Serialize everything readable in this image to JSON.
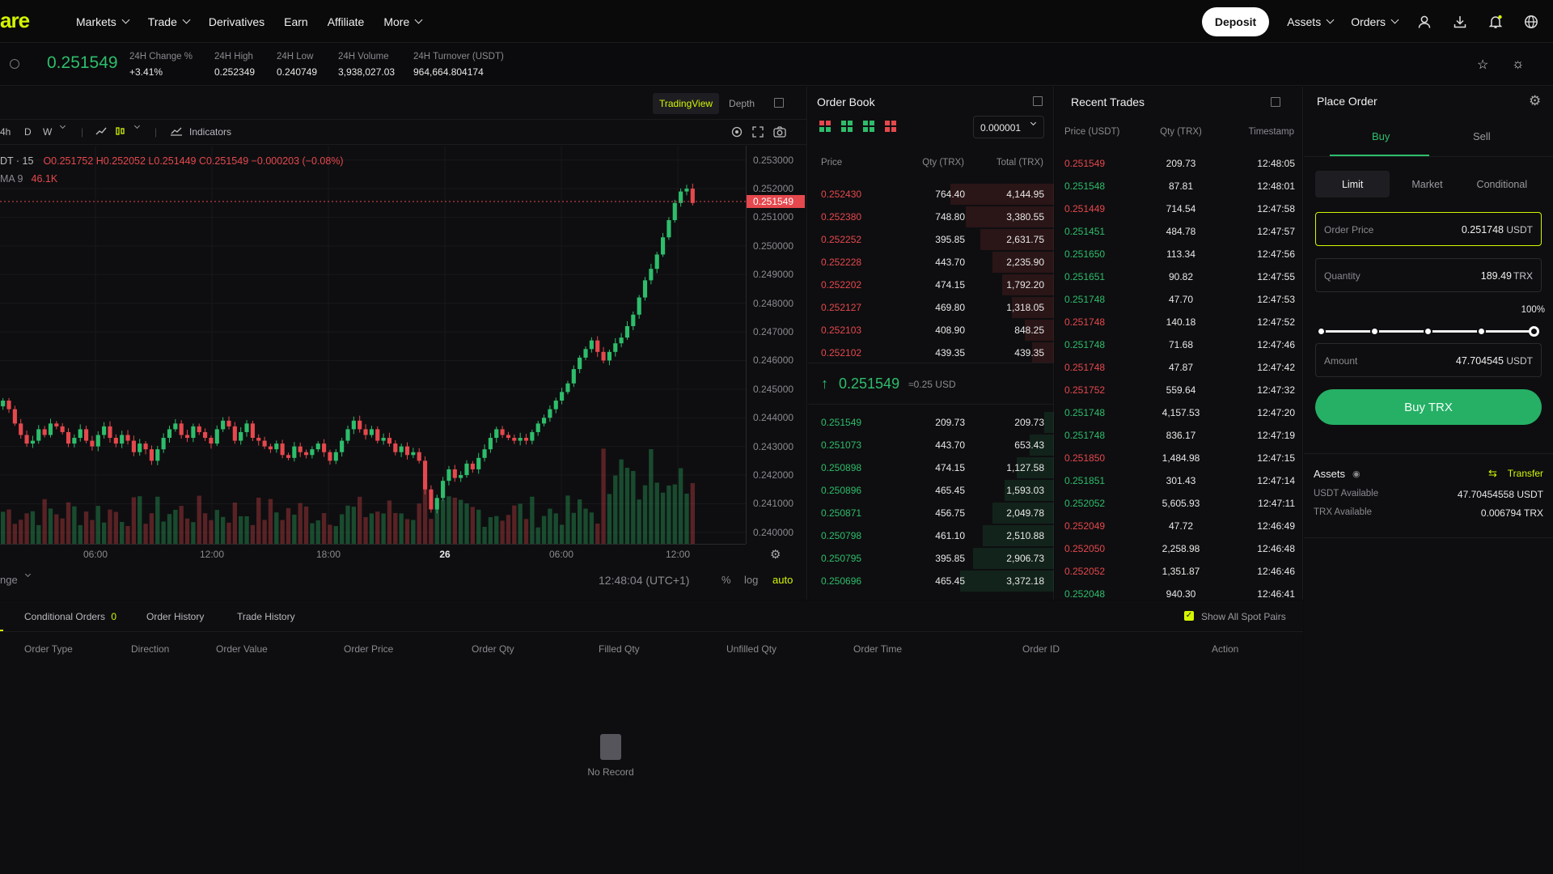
{
  "brand": {
    "logo_text": "are"
  },
  "nav": {
    "items": [
      {
        "label": "Markets",
        "dropdown": true
      },
      {
        "label": "Trade",
        "dropdown": true
      },
      {
        "label": "Derivatives",
        "dropdown": false
      },
      {
        "label": "Earn",
        "dropdown": false
      },
      {
        "label": "Affiliate",
        "dropdown": false
      },
      {
        "label": "More",
        "dropdown": true
      }
    ]
  },
  "top_right": {
    "deposit_label": "Deposit",
    "assets_label": "Assets",
    "orders_label": "Orders",
    "icons": [
      "user-icon",
      "download-icon",
      "bell-icon",
      "globe-icon"
    ]
  },
  "ticker": {
    "last_price": "0.251549",
    "change_label": "24H Change %",
    "change_value": "+3.41%",
    "high_label": "24H High",
    "high_value": "0.252349",
    "low_label": "24H Low",
    "low_value": "0.240749",
    "volume_label": "24H Volume",
    "volume_value": "3,938,027.03",
    "turnover_label": "24H Turnover (USDT)",
    "turnover_value": "964,664.804174"
  },
  "chart": {
    "view_tabs": [
      "TradingView",
      "Depth"
    ],
    "active_view": "TradingView",
    "toolbar": {
      "intervals": [
        "4h",
        "D",
        "W"
      ],
      "indicators_label": "Indicators"
    },
    "symbol_label": "DT · 15",
    "ohlc": "O0.251752  H0.252052  L0.251449  C0.251549  −0.000203 (−0.08%)",
    "ma_label": "MA 9",
    "ma_value": "46.1K",
    "current_price_tag": "0.251549",
    "time_readout": "12:48:04 (UTC+1)",
    "range_label": "nge",
    "footer_toggles": [
      "%",
      "log",
      "auto"
    ]
  },
  "chart_data": {
    "type": "candlestick",
    "title": "",
    "y_ticks": [
      "0.253000",
      "0.252000",
      "0.251000",
      "0.250000",
      "0.249000",
      "0.248000",
      "0.247000",
      "0.246000",
      "0.245000",
      "0.244000",
      "0.243000",
      "0.242000",
      "0.241000",
      "0.240000"
    ],
    "ylim": [
      0.2396,
      0.2535
    ],
    "x_ticks": [
      "06:00",
      "12:00",
      "18:00",
      "26",
      "06:00",
      "12:00"
    ],
    "close_series": [
      0.2446,
      0.2443,
      0.2438,
      0.2434,
      0.2431,
      0.2432,
      0.2436,
      0.2434,
      0.2438,
      0.2437,
      0.2435,
      0.2431,
      0.2433,
      0.2436,
      0.2432,
      0.243,
      0.2434,
      0.2437,
      0.2433,
      0.2431,
      0.2434,
      0.2432,
      0.2428,
      0.2431,
      0.2429,
      0.2425,
      0.2429,
      0.2433,
      0.2436,
      0.2438,
      0.2434,
      0.2433,
      0.2437,
      0.2435,
      0.2433,
      0.2431,
      0.2436,
      0.2439,
      0.2437,
      0.2432,
      0.2435,
      0.2438,
      0.2433,
      0.2432,
      0.243,
      0.2429,
      0.2431,
      0.2427,
      0.2426,
      0.243,
      0.2428,
      0.2427,
      0.2429,
      0.2431,
      0.2428,
      0.2425,
      0.2428,
      0.2432,
      0.2436,
      0.2439,
      0.2436,
      0.2434,
      0.2436,
      0.2432,
      0.2433,
      0.2431,
      0.2428,
      0.243,
      0.2427,
      0.2428,
      0.2425,
      0.2415,
      0.2408,
      0.2412,
      0.2418,
      0.2422,
      0.2419,
      0.242,
      0.2424,
      0.2422,
      0.2426,
      0.2429,
      0.2433,
      0.2436,
      0.2434,
      0.2433,
      0.2432,
      0.2433,
      0.2432,
      0.2435,
      0.2438,
      0.244,
      0.2443,
      0.2446,
      0.2449,
      0.2452,
      0.2457,
      0.2461,
      0.2464,
      0.2467,
      0.2463,
      0.246,
      0.2463,
      0.2466,
      0.2468,
      0.2472,
      0.2476,
      0.2482,
      0.2488,
      0.2492,
      0.2497,
      0.2503,
      0.2509,
      0.2515,
      0.2519,
      0.252,
      0.2515
    ]
  },
  "order_book": {
    "title": "Order Book",
    "precision": "0.000001",
    "col_price": "Price",
    "col_qty": "Qty (TRX)",
    "col_total": "Total (TRX)",
    "asks": [
      {
        "price": "0.252430",
        "qty": "764.40",
        "total": "4,144.95",
        "depth": 0.42
      },
      {
        "price": "0.252380",
        "qty": "748.80",
        "total": "3,380.55",
        "depth": 0.36
      },
      {
        "price": "0.252252",
        "qty": "395.85",
        "total": "2,631.75",
        "depth": 0.3
      },
      {
        "price": "0.252228",
        "qty": "443.70",
        "total": "2,235.90",
        "depth": 0.25
      },
      {
        "price": "0.252202",
        "qty": "474.15",
        "total": "1,792.20",
        "depth": 0.21
      },
      {
        "price": "0.252127",
        "qty": "469.80",
        "total": "1,318.05",
        "depth": 0.17
      },
      {
        "price": "0.252103",
        "qty": "408.90",
        "total": "848.25",
        "depth": 0.12
      },
      {
        "price": "0.252102",
        "qty": "439.35",
        "total": "439.35",
        "depth": 0.09
      }
    ],
    "mid_price": "0.251549",
    "mid_usd": "≈0.25 USD",
    "bids": [
      {
        "price": "0.251549",
        "qty": "209.73",
        "total": "209.73",
        "depth": 0.04
      },
      {
        "price": "0.251073",
        "qty": "443.70",
        "total": "653.43",
        "depth": 0.1
      },
      {
        "price": "0.250898",
        "qty": "474.15",
        "total": "1,127.58",
        "depth": 0.15
      },
      {
        "price": "0.250896",
        "qty": "465.45",
        "total": "1,593.03",
        "depth": 0.2
      },
      {
        "price": "0.250871",
        "qty": "456.75",
        "total": "2,049.78",
        "depth": 0.25
      },
      {
        "price": "0.250798",
        "qty": "461.10",
        "total": "2,510.88",
        "depth": 0.29
      },
      {
        "price": "0.250795",
        "qty": "395.85",
        "total": "2,906.73",
        "depth": 0.33
      },
      {
        "price": "0.250696",
        "qty": "465.45",
        "total": "3,372.18",
        "depth": 0.38
      }
    ]
  },
  "recent_trades": {
    "title": "Recent Trades",
    "col_price": "Price (USDT)",
    "col_qty": "Qty (TRX)",
    "col_time": "Timestamp",
    "rows": [
      {
        "price": "0.251549",
        "qty": "209.73",
        "time": "12:48:05",
        "side": "sell"
      },
      {
        "price": "0.251548",
        "qty": "87.81",
        "time": "12:48:01",
        "side": "buy"
      },
      {
        "price": "0.251449",
        "qty": "714.54",
        "time": "12:47:58",
        "side": "sell"
      },
      {
        "price": "0.251451",
        "qty": "484.78",
        "time": "12:47:57",
        "side": "buy"
      },
      {
        "price": "0.251650",
        "qty": "113.34",
        "time": "12:47:56",
        "side": "buy"
      },
      {
        "price": "0.251651",
        "qty": "90.82",
        "time": "12:47:55",
        "side": "buy"
      },
      {
        "price": "0.251748",
        "qty": "47.70",
        "time": "12:47:53",
        "side": "buy"
      },
      {
        "price": "0.251748",
        "qty": "140.18",
        "time": "12:47:52",
        "side": "sell"
      },
      {
        "price": "0.251748",
        "qty": "71.68",
        "time": "12:47:46",
        "side": "buy"
      },
      {
        "price": "0.251748",
        "qty": "47.87",
        "time": "12:47:42",
        "side": "sell"
      },
      {
        "price": "0.251752",
        "qty": "559.64",
        "time": "12:47:32",
        "side": "sell"
      },
      {
        "price": "0.251748",
        "qty": "4,157.53",
        "time": "12:47:20",
        "side": "buy"
      },
      {
        "price": "0.251748",
        "qty": "836.17",
        "time": "12:47:19",
        "side": "buy"
      },
      {
        "price": "0.251850",
        "qty": "1,484.98",
        "time": "12:47:15",
        "side": "sell"
      },
      {
        "price": "0.251851",
        "qty": "301.43",
        "time": "12:47:14",
        "side": "buy"
      },
      {
        "price": "0.252052",
        "qty": "5,605.93",
        "time": "12:47:11",
        "side": "buy"
      },
      {
        "price": "0.252049",
        "qty": "47.72",
        "time": "12:46:49",
        "side": "sell"
      },
      {
        "price": "0.252050",
        "qty": "2,258.98",
        "time": "12:46:48",
        "side": "sell"
      },
      {
        "price": "0.252052",
        "qty": "1,351.87",
        "time": "12:46:46",
        "side": "sell"
      },
      {
        "price": "0.252048",
        "qty": "940.30",
        "time": "12:46:41",
        "side": "buy"
      }
    ]
  },
  "place_order": {
    "title": "Place Order",
    "side_buy": "Buy",
    "side_sell": "Sell",
    "types": [
      "Limit",
      "Market",
      "Conditional"
    ],
    "active_type": "Limit",
    "order_price_label": "Order Price",
    "order_price_value": "0.251748",
    "order_price_unit": "USDT",
    "quantity_label": "Quantity",
    "quantity_value": "189.49",
    "quantity_unit": "TRX",
    "slider_percent_label": "100%",
    "slider_value": 1.0,
    "amount_label": "Amount",
    "amount_value": "47.704545",
    "amount_unit": "USDT",
    "buy_button": "Buy TRX"
  },
  "assets": {
    "title": "Assets",
    "transfer_label": "Transfer",
    "rows": [
      {
        "label": "USDT Available",
        "value": "47.70454558 USDT"
      },
      {
        "label": "TRX Available",
        "value": "0.006794 TRX"
      }
    ]
  },
  "orders_panel": {
    "tabs": [
      {
        "label": "Conditional Orders",
        "count": "0"
      },
      {
        "label": "Order History",
        "count": ""
      },
      {
        "label": "Trade History",
        "count": ""
      }
    ],
    "show_all_label": "Show All Spot Pairs",
    "show_all_checked": true,
    "columns": [
      "Order Type",
      "Direction",
      "Order Value",
      "Order Price",
      "Order Qty",
      "Filled Qty",
      "Unfilled Qty",
      "Order Time",
      "Order ID",
      "Action"
    ],
    "empty_text": "No Record"
  },
  "colors": {
    "accent": "#d5f600",
    "up": "#2ebd6b",
    "down": "#e5484d",
    "bg": "#0e0e10"
  }
}
